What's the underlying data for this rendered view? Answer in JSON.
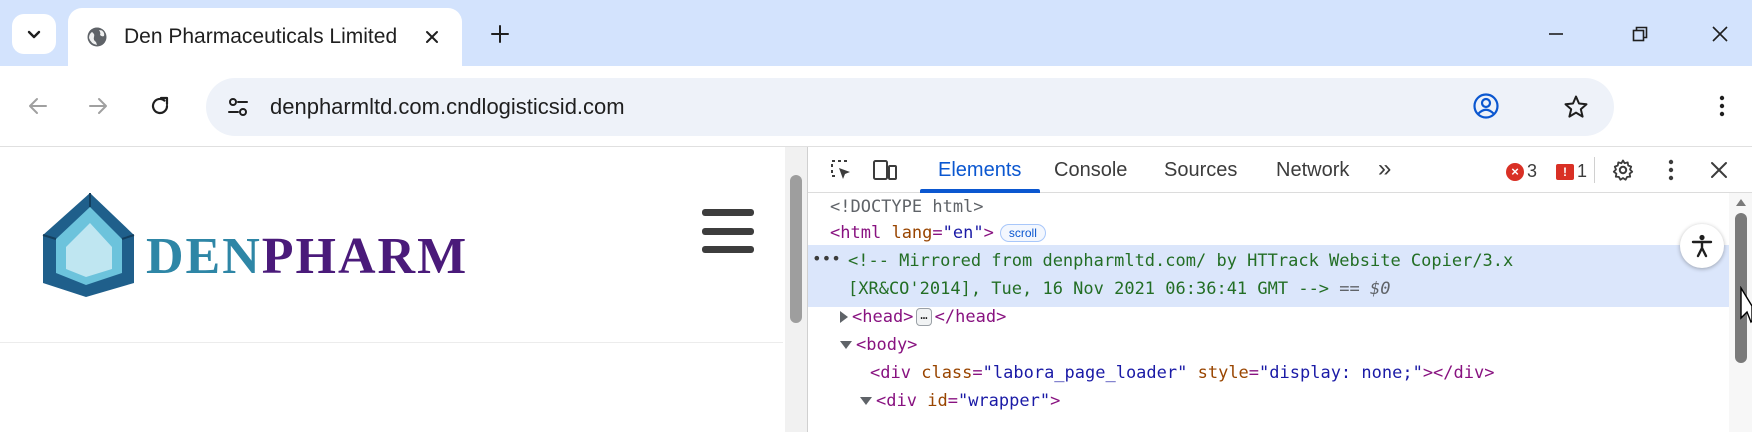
{
  "tab": {
    "title": "Den Pharmaceuticals Limited"
  },
  "omnibox": {
    "url": "denpharmltd.com.cndlogisticsid.com"
  },
  "site": {
    "logo_prefix": "DEN",
    "logo_suffix": "PHARM",
    "colors": {
      "logo_prefix": "#2e86a6",
      "logo_suffix": "#4a1a7a",
      "house_light": "#6cc3dc",
      "house_dark": "#1f5f8b"
    }
  },
  "devtools": {
    "tabs": [
      {
        "label": "Elements"
      },
      {
        "label": "Console"
      },
      {
        "label": "Sources"
      },
      {
        "label": "Network"
      }
    ],
    "more_tabs": "»",
    "error_count": "3",
    "issue_count": "1",
    "dom": {
      "doctype": "<!DOCTYPE html>",
      "html_open": "<html lang=\"en\">",
      "html_tag": "html",
      "html_attr": "lang",
      "html_val": "\"en\"",
      "scroll_pill": "scroll",
      "comment_line1": "<!-- Mirrored from denpharmltd.com/ by HTTrack Website Copier/3.x",
      "comment_line2": "[XR&CO'2014], Tue, 16 Nov 2021 06:36:41 GMT -->",
      "selected_marker": "== $0",
      "head_open": "<head>",
      "head_close": "</head>",
      "body_open": "<body>",
      "div1_tag": "div",
      "div1_attr1": "class",
      "div1_val1": "\"labora_page_loader\"",
      "div1_attr2": "style",
      "div1_val2": "\"display: none;\"",
      "div1_close": "></div>",
      "div2_tag": "div",
      "div2_attr": "id",
      "div2_val": "\"wrapper\""
    }
  }
}
